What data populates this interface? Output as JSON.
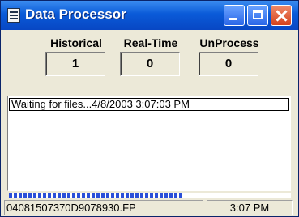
{
  "window": {
    "title": "Data Processor",
    "icon": "app-list-icon",
    "controls": [
      "minimize-icon",
      "maximize-icon",
      "close-icon"
    ]
  },
  "counters": [
    {
      "label": "Historical",
      "value": "1"
    },
    {
      "label": "Real-Time",
      "value": "0"
    },
    {
      "label": "UnProcess",
      "value": "0"
    }
  ],
  "log": {
    "lines": [
      "Waiting for files...4/8/2003 3:07:03 PM"
    ]
  },
  "progress": {
    "fraction": 0.62,
    "color": "#2a4fd8"
  },
  "status": {
    "file": "04081507370D9078930.FP",
    "time": "3:07 PM"
  },
  "colors": {
    "titlebar": "#0a5ad8",
    "face": "#ece9d8",
    "close": "#d4421c"
  }
}
